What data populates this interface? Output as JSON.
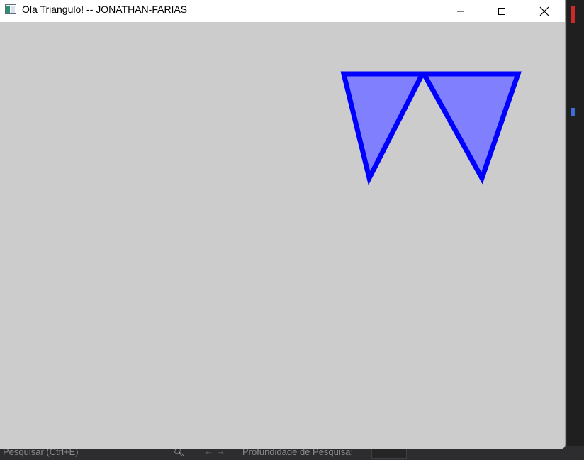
{
  "window": {
    "title": "Ola Triangulo! -- JONATHAN-FARIAS",
    "canvas_background": "#cccccc",
    "controls": {
      "minimize_icon": "minimize-icon",
      "maximize_icon": "maximize-icon",
      "close_icon": "close-icon"
    }
  },
  "scene": {
    "fill_color": "#8080ff",
    "stroke_color": "#0000ff"
  },
  "background_app": {
    "search_hint": "Pesquisar (Ctrl+E)",
    "depth_label": "Profundidade de Pesquisa:"
  }
}
